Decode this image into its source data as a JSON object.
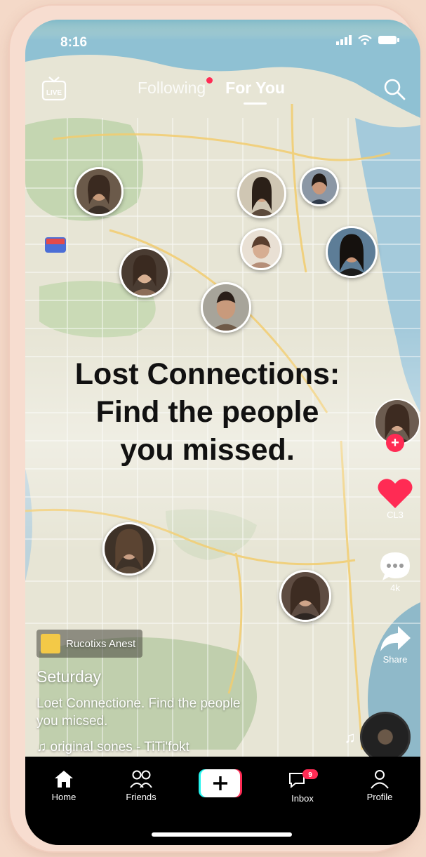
{
  "status": {
    "time": "8:16"
  },
  "topnav": {
    "live_label": "LIVE",
    "tab_following": "Following",
    "tab_foryou": "For You"
  },
  "headline": [
    "Lost Connections:",
    "Find the people",
    "you missed."
  ],
  "rightbar": {
    "like_count": "CL3",
    "comment_count": "4k",
    "share_label": "Share"
  },
  "caption": {
    "badge_text": "Rucotixs Anest",
    "username": "Seturday",
    "description_line1": "Loet Connectione. Find the people",
    "description_line2": "you micsed.",
    "sound": "♫ original sones - TiTi'fokt"
  },
  "bottomnav": {
    "home": "Home",
    "friends": "Friends",
    "inbox": "Inbox",
    "inbox_badge": "9",
    "profile": "Profile"
  },
  "colors": {
    "accent": "#ff2b54",
    "map_base": "#e7e4d6",
    "water": "#9cc7db"
  }
}
